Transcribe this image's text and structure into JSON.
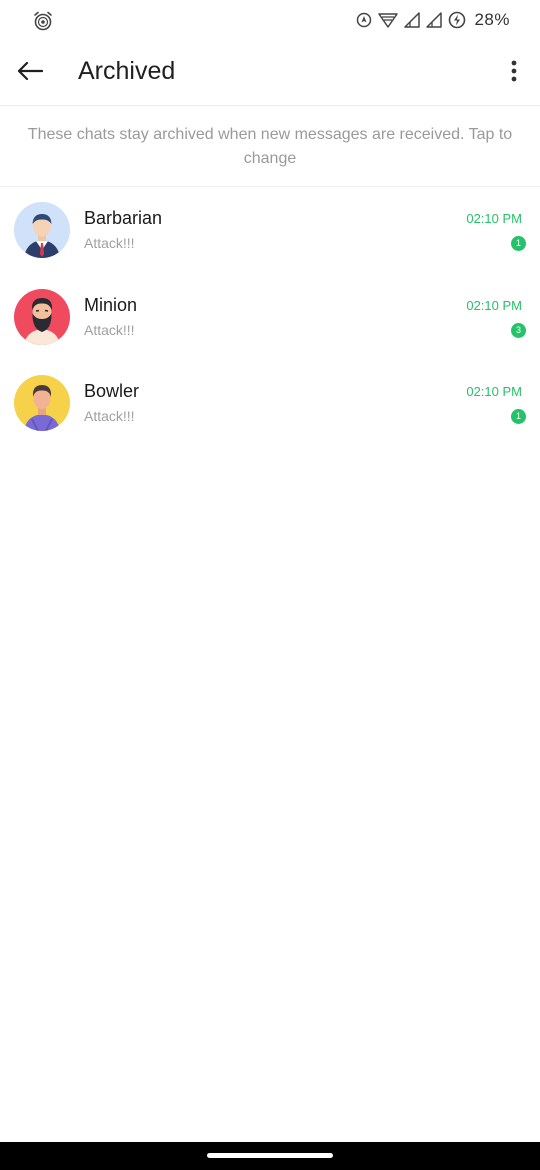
{
  "status_bar": {
    "left_icon": "alarm-clock-icon",
    "right_icons": [
      "location-icon",
      "wifi-icon",
      "signal-icon",
      "signal-icon"
    ],
    "battery_icon": "battery-charging-icon",
    "battery_text": "28%"
  },
  "header": {
    "back_icon": "arrow-left-icon",
    "title": "Archived",
    "more_icon": "more-vertical-icon"
  },
  "banner": {
    "text": "These chats stay archived when new messages are received. Tap to change"
  },
  "chats": [
    {
      "name": "Barbarian",
      "message": "Attack!!!",
      "time": "02:10 PM",
      "unread": "1",
      "avatar": "businessman-avatar"
    },
    {
      "name": "Minion",
      "message": "Attack!!!",
      "time": "02:10 PM",
      "unread": "3",
      "avatar": "bearded-man-avatar"
    },
    {
      "name": "Bowler",
      "message": "Attack!!!",
      "time": "02:10 PM",
      "unread": "1",
      "avatar": "casual-man-avatar"
    }
  ],
  "colors": {
    "accent": "#25c26a",
    "secondary_text": "#a0a0a0",
    "divider": "#ececec"
  }
}
